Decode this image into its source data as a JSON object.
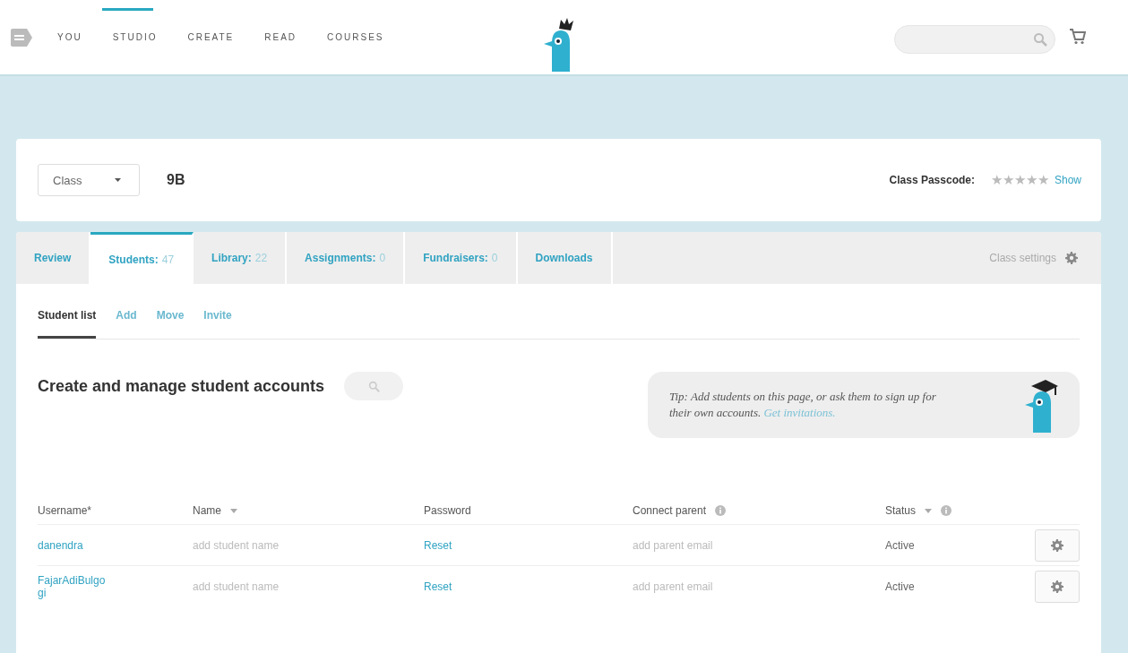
{
  "nav": {
    "items": [
      {
        "label": "YOU",
        "selected": false
      },
      {
        "label": "STUDIO",
        "selected": true
      },
      {
        "label": "CREATE",
        "selected": false
      },
      {
        "label": "READ",
        "selected": false
      },
      {
        "label": "COURSES",
        "selected": false
      }
    ]
  },
  "class_bar": {
    "class_select": "Class",
    "class_name": "9B",
    "passcode_label": "Class Passcode:",
    "passcode": "★★★★★",
    "show_link": "Show"
  },
  "tabs": [
    {
      "label": "Review",
      "selected": false
    },
    {
      "label": "Students:",
      "count": "47",
      "selected": true
    },
    {
      "label": "Library:",
      "count": "22",
      "selected": false
    },
    {
      "label": "Assignments:",
      "count": "0",
      "selected": false
    },
    {
      "label": "Fundraisers:",
      "count": "0",
      "selected": false
    },
    {
      "label": "Downloads",
      "selected": false
    }
  ],
  "class_settings": "Class settings",
  "subtabs": [
    {
      "label": "Student list",
      "selected": true
    },
    {
      "label": "Add",
      "selected": false
    },
    {
      "label": "Move",
      "selected": false
    },
    {
      "label": "Invite",
      "selected": false
    }
  ],
  "heading": "Create and manage student accounts",
  "tip": {
    "text": "Tip: Add students on this page, or ask them to sign up for their own accounts.",
    "link": "Get invitations."
  },
  "table": {
    "columns": [
      {
        "label": "Username*",
        "kind": "plain"
      },
      {
        "label": "Name",
        "kind": "sort"
      },
      {
        "label": "Password",
        "kind": "plain"
      },
      {
        "label": "Connect parent",
        "kind": "info"
      },
      {
        "label": "Status",
        "kind": "sort-info"
      }
    ],
    "rows": [
      {
        "username": "danendra",
        "name": "add student name",
        "password": "Reset",
        "parent": "add parent email",
        "status": "Active"
      },
      {
        "username": "FajarAdiBulgogi",
        "name": "add student name",
        "password": "Reset",
        "parent": "add parent email",
        "status": "Active"
      }
    ]
  }
}
